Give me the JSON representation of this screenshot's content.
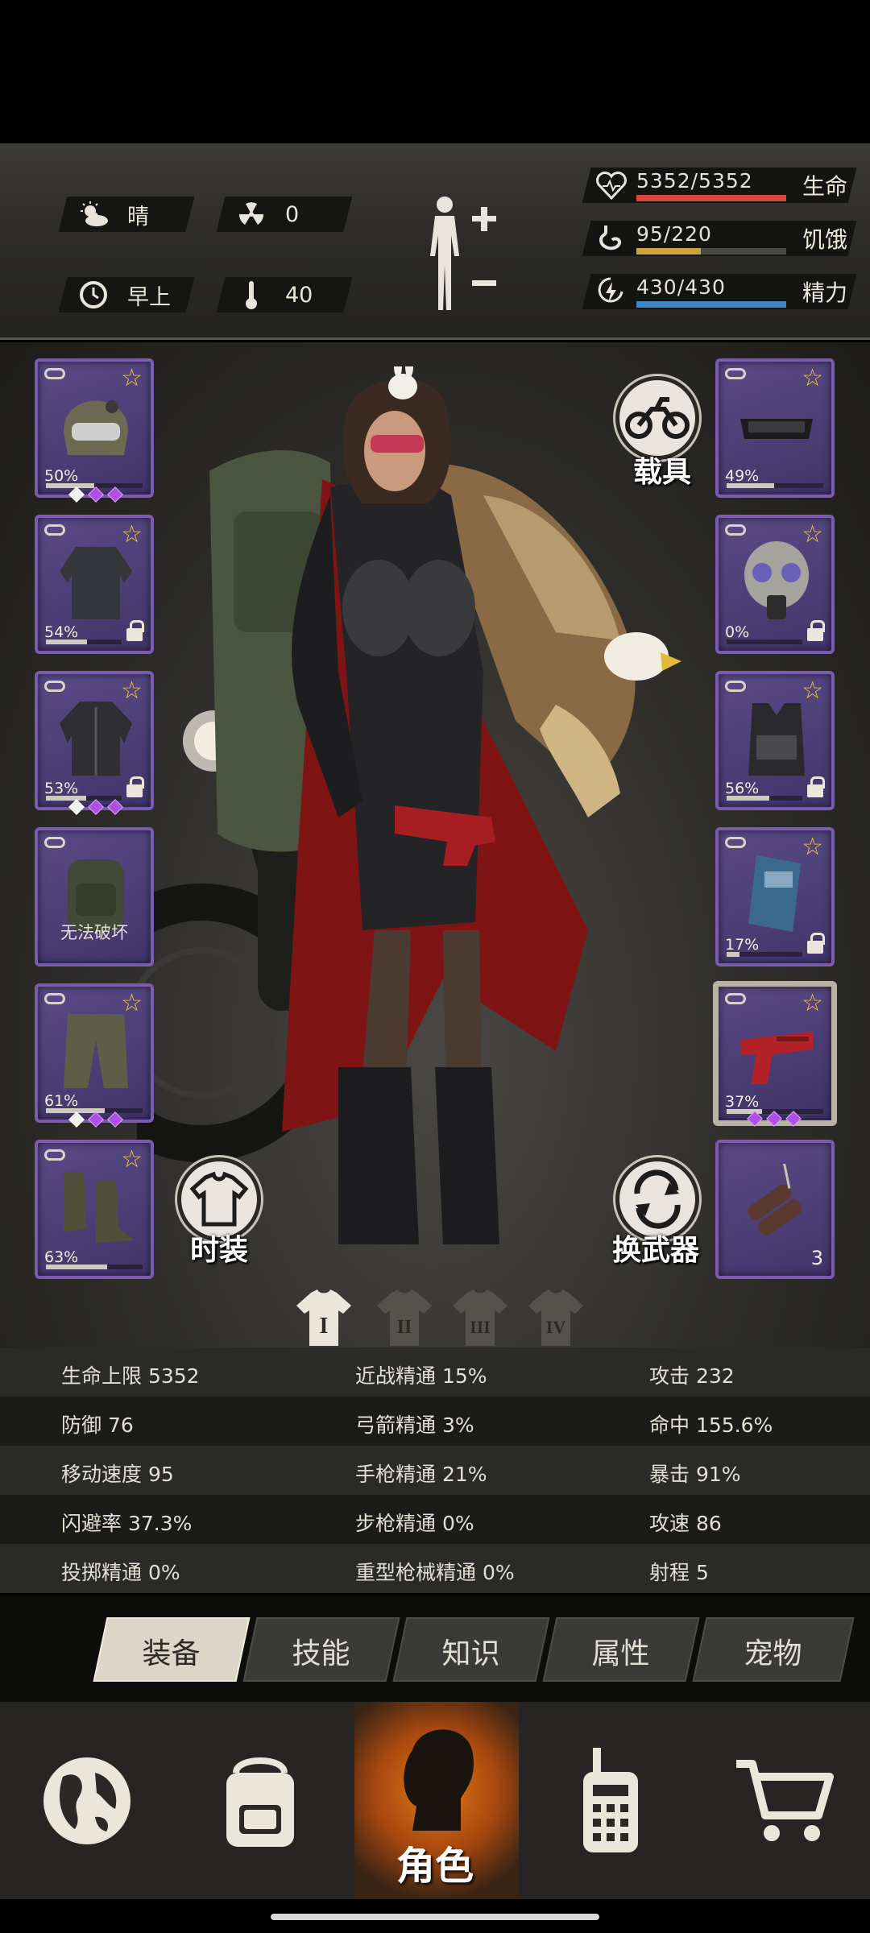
{
  "weather": {
    "label": "晴",
    "icon": "sun-cloud-icon"
  },
  "radiation": {
    "value": "0",
    "icon": "radiation-icon"
  },
  "time_of_day": {
    "label": "早上",
    "icon": "clock-icon"
  },
  "temperature": {
    "value": "40",
    "icon": "thermometer-icon"
  },
  "vitals": [
    {
      "value": "5352/5352",
      "label": "生命",
      "icon": "heart-icon",
      "color": "#d9463a",
      "fill": 1.0
    },
    {
      "value": "95/220",
      "label": "饥饿",
      "icon": "stomach-icon",
      "color": "#d1a23b",
      "fill": 0.43
    },
    {
      "value": "430/430",
      "label": "精力",
      "icon": "energy-icon",
      "color": "#3f86c7",
      "fill": 1.0
    }
  ],
  "left_slots": [
    {
      "name": "helmet",
      "pct": "50%",
      "durability": 0.5,
      "lock": false,
      "gems": [
        "w",
        "p",
        "p"
      ]
    },
    {
      "name": "jacket",
      "pct": "54%",
      "durability": 0.54,
      "lock": true,
      "gems": []
    },
    {
      "name": "coat",
      "pct": "53%",
      "durability": 0.53,
      "lock": true,
      "gems": [
        "w",
        "p",
        "p"
      ]
    },
    {
      "name": "backpack",
      "caption": "无法破坏",
      "lock": false,
      "gems": []
    },
    {
      "name": "pants",
      "pct": "61%",
      "durability": 0.61,
      "lock": false,
      "gems": [
        "w",
        "p",
        "p"
      ]
    },
    {
      "name": "boots",
      "pct": "63%",
      "durability": 0.63,
      "lock": false,
      "gems": []
    }
  ],
  "right_slots": [
    {
      "name": "goggles",
      "pct": "49%",
      "durability": 0.49,
      "lock": false
    },
    {
      "name": "gas-mask",
      "pct": "0%",
      "durability": 0.0,
      "lock": true
    },
    {
      "name": "vest",
      "pct": "56%",
      "durability": 0.56,
      "lock": true
    },
    {
      "name": "shield",
      "pct": "17%",
      "durability": 0.17,
      "lock": true
    },
    {
      "name": "pistol",
      "pct": "37%",
      "durability": 0.37,
      "lock": false,
      "selected": true,
      "gems": [
        "p",
        "p",
        "p"
      ]
    },
    {
      "name": "grenade",
      "count": "3"
    }
  ],
  "buttons": {
    "vehicle": "载具",
    "fashion": "时装",
    "swap_weapon": "换武器"
  },
  "outfit_tabs": [
    "I",
    "II",
    "III",
    "IV"
  ],
  "stats": [
    [
      "生命上限 5352",
      "近战精通 15%",
      "攻击 232"
    ],
    [
      "防御 76",
      "弓箭精通 3%",
      "命中 155.6%"
    ],
    [
      "移动速度 95",
      "手枪精通 21%",
      "暴击 91%"
    ],
    [
      "闪避率 37.3%",
      "步枪精通 0%",
      "攻速 86"
    ],
    [
      "投掷精通 0%",
      "重型枪械精通 0%",
      "射程 5"
    ]
  ],
  "tabs": [
    {
      "label": "装备",
      "active": true
    },
    {
      "label": "技能"
    },
    {
      "label": "知识"
    },
    {
      "label": "属性"
    },
    {
      "label": "宠物"
    }
  ],
  "nav": [
    {
      "name": "world-map",
      "icon": "globe-icon"
    },
    {
      "name": "inventory",
      "icon": "backpack-icon"
    },
    {
      "name": "character",
      "icon": "character-head-icon",
      "label": "角色",
      "active": true
    },
    {
      "name": "radio",
      "icon": "walkie-talkie-icon"
    },
    {
      "name": "shop",
      "icon": "cart-icon"
    }
  ]
}
